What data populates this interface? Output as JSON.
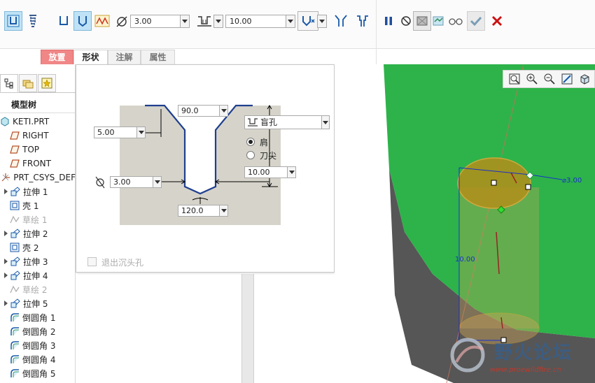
{
  "toolbar": {
    "diameter_value": "3.00",
    "depth_value": "10.00",
    "colors": {
      "active_bg": "#bfe2f6",
      "pause": "#1f4e9b",
      "ok": "#2e8b57",
      "cancel": "#cc1111"
    }
  },
  "tabs": [
    {
      "label": "放置",
      "state": "highlight"
    },
    {
      "label": "形状",
      "state": "active"
    },
    {
      "label": "注解",
      "state": "normal"
    },
    {
      "label": "属性",
      "state": "normal"
    }
  ],
  "tree": {
    "title": "模型树",
    "items": [
      {
        "label": "KETI.PRT",
        "icon": "part-icon",
        "expand": false,
        "dim": false
      },
      {
        "label": "RIGHT",
        "icon": "datum-plane-icon",
        "expand": false,
        "dim": false
      },
      {
        "label": "TOP",
        "icon": "datum-plane-icon",
        "expand": false,
        "dim": false
      },
      {
        "label": "FRONT",
        "icon": "datum-plane-icon",
        "expand": false,
        "dim": false
      },
      {
        "label": "PRT_CSYS_DEF",
        "icon": "csys-icon",
        "expand": false,
        "dim": false
      },
      {
        "label": "拉伸 1",
        "icon": "extrude-icon",
        "expand": true,
        "dim": false
      },
      {
        "label": "壳 1",
        "icon": "shell-icon",
        "expand": false,
        "dim": false
      },
      {
        "label": "草绘 1",
        "icon": "sketch-icon",
        "expand": false,
        "dim": true
      },
      {
        "label": "拉伸 2",
        "icon": "extrude-icon",
        "expand": true,
        "dim": false
      },
      {
        "label": "壳 2",
        "icon": "shell-icon",
        "expand": false,
        "dim": false
      },
      {
        "label": "拉伸 3",
        "icon": "extrude-icon",
        "expand": true,
        "dim": false
      },
      {
        "label": "拉伸 4",
        "icon": "extrude-icon",
        "expand": true,
        "dim": false
      },
      {
        "label": "草绘 2",
        "icon": "sketch-icon",
        "expand": false,
        "dim": true
      },
      {
        "label": "拉伸 5",
        "icon": "extrude-icon",
        "expand": true,
        "dim": false
      },
      {
        "label": "倒圆角 1",
        "icon": "round-icon",
        "expand": false,
        "dim": false
      },
      {
        "label": "倒圆角 2",
        "icon": "round-icon",
        "expand": false,
        "dim": false
      },
      {
        "label": "倒圆角 3",
        "icon": "round-icon",
        "expand": false,
        "dim": false
      },
      {
        "label": "倒圆角 4",
        "icon": "round-icon",
        "expand": false,
        "dim": false
      },
      {
        "label": "倒圆角 5",
        "icon": "round-icon",
        "expand": false,
        "dim": false
      }
    ]
  },
  "shape_panel": {
    "countersink_angle": "90.0",
    "countersink_offset": "5.00",
    "diameter": "3.00",
    "tip_angle": "120.0",
    "depth_type": "盲孔",
    "depth": "10.00",
    "radio_shoulder": "肩",
    "radio_tip": "刀尖",
    "radio_selected": "shoulder",
    "exit_countersink_label": "退出沉头孔",
    "exit_countersink_checked": false
  },
  "viewport": {
    "dim_diameter": "⌀3.00",
    "dim_depth": "10.00",
    "model_color": "#2db34a",
    "hole_color": "#e6a93a"
  },
  "watermark": {
    "title": "野火论坛",
    "url": "www.proewildfire.cn"
  }
}
